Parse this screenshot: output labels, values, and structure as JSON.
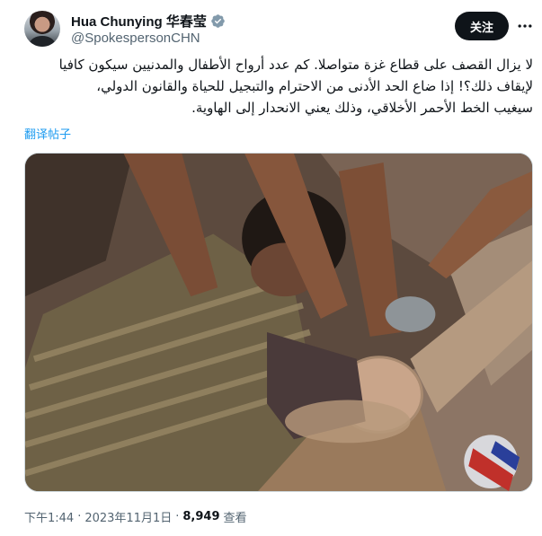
{
  "author": {
    "display_name": "Hua Chunying 华春莹",
    "handle": "@SpokespersonCHN",
    "verified_color": "#829aab"
  },
  "actions": {
    "follow_label": "关注",
    "more_icon": "more-dots-icon"
  },
  "tweet": {
    "lines": [
      "لا يزال القصف على قطاع غزة متواصلا. كم عدد أرواح الأطفال والمدنيين سيكون كافيا",
      "لإيقاف ذلك؟! إذا ضاع الحد الأدنى من الاحترام والتبجيل للحياة والقانون الدولي،",
      "سيغيب الخط الأحمر الأخلاقي، وذلك يعني الانحدار إلى الهاوية."
    ],
    "translate_label": "翻译帖子"
  },
  "meta": {
    "time": "下午1:44",
    "separator": "·",
    "date": "2023年11月1日",
    "views_count": "8,949",
    "views_label": "查看"
  },
  "colors": {
    "accent": "#1d9bf0",
    "text": "#0f1419",
    "secondary": "#536471",
    "button": "#0f1419"
  }
}
